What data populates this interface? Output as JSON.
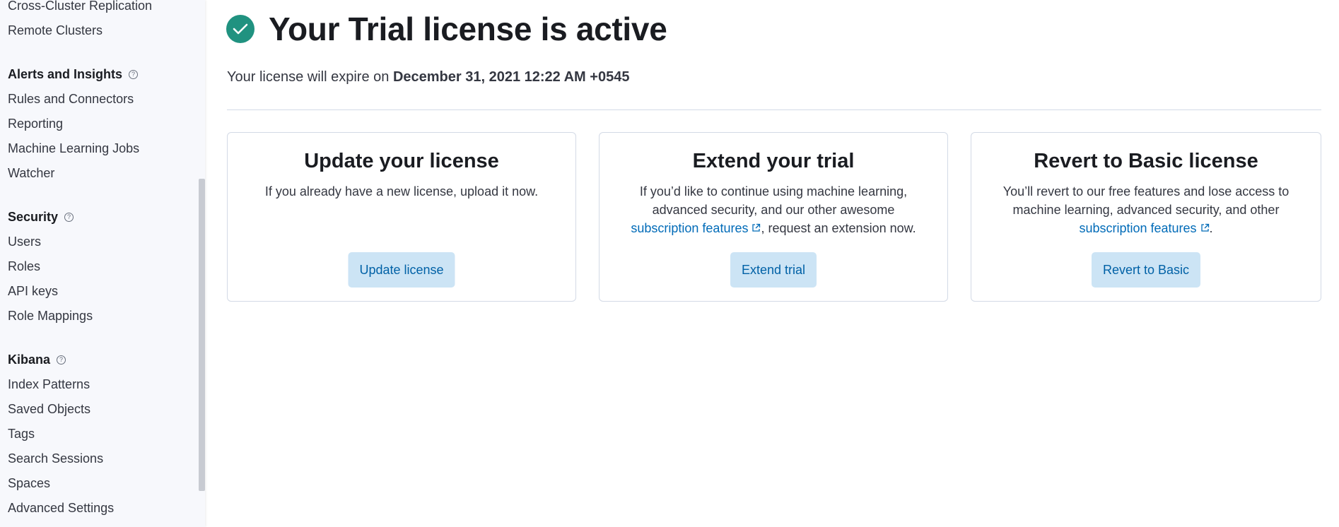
{
  "sidebar": {
    "top_items": [
      {
        "label": "Cross-Cluster Replication"
      },
      {
        "label": "Remote Clusters"
      }
    ],
    "groups": [
      {
        "title": "Alerts and Insights",
        "items": [
          {
            "label": "Rules and Connectors"
          },
          {
            "label": "Reporting"
          },
          {
            "label": "Machine Learning Jobs"
          },
          {
            "label": "Watcher"
          }
        ]
      },
      {
        "title": "Security",
        "items": [
          {
            "label": "Users"
          },
          {
            "label": "Roles"
          },
          {
            "label": "API keys"
          },
          {
            "label": "Role Mappings"
          }
        ]
      },
      {
        "title": "Kibana",
        "items": [
          {
            "label": "Index Patterns"
          },
          {
            "label": "Saved Objects"
          },
          {
            "label": "Tags"
          },
          {
            "label": "Search Sessions"
          },
          {
            "label": "Spaces"
          },
          {
            "label": "Advanced Settings"
          }
        ]
      }
    ],
    "help_icon_glyph": "?"
  },
  "main": {
    "title": "Your Trial license is active",
    "status_icon": "check-circle-icon",
    "status_color": "#209280",
    "expiry_prefix": "Your license will expire on ",
    "expiry_date": "December 31, 2021 12:22 AM +0545",
    "cards": [
      {
        "title": "Update your license",
        "desc": "If you already have a new license, upload it now.",
        "button": "Update license"
      },
      {
        "title": "Extend your trial",
        "desc_before": "If you’d like to continue using machine learning, advanced security, and our other awesome ",
        "link": "subscription features",
        "desc_after": ", request an extension now.",
        "button": "Extend trial"
      },
      {
        "title": "Revert to Basic license",
        "desc_before": "You’ll revert to our free features and lose access to machine learning, advanced security, and other ",
        "link": "subscription features",
        "desc_after": ".",
        "button": "Revert to Basic"
      }
    ]
  }
}
